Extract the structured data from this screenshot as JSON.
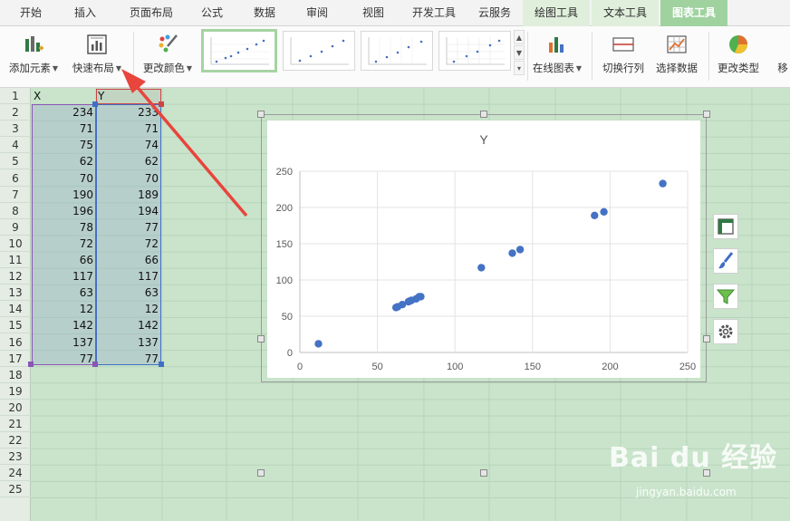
{
  "tabs": [
    "开始",
    "插入",
    "页面布局",
    "公式",
    "数据",
    "审阅",
    "视图",
    "开发工具",
    "云服务",
    "绘图工具",
    "文本工具",
    "图表工具"
  ],
  "ribbon": {
    "add_element": "添加元素",
    "quick_layout": "快速布局",
    "change_color": "更改颜色",
    "online_chart": "在线图表",
    "switch_row_col": "切换行列",
    "select_data": "选择数据",
    "change_type": "更改类型",
    "move": "移"
  },
  "sheet": {
    "rows": [
      "1",
      "2",
      "3",
      "4",
      "5",
      "6",
      "7",
      "8",
      "9",
      "10",
      "11",
      "12",
      "13",
      "14",
      "15",
      "16",
      "17",
      "18",
      "19",
      "20",
      "21",
      "22",
      "23",
      "24",
      "25"
    ],
    "header": {
      "x": "X",
      "y": "Y"
    },
    "x_values": [
      "234",
      "71",
      "75",
      "62",
      "70",
      "190",
      "196",
      "78",
      "72",
      "66",
      "117",
      "63",
      "12",
      "142",
      "137",
      "77"
    ],
    "y_values": [
      "233",
      "71",
      "74",
      "62",
      "70",
      "189",
      "194",
      "77",
      "72",
      "66",
      "117",
      "63",
      "12",
      "142",
      "137",
      "77"
    ]
  },
  "chart_data": {
    "type": "scatter",
    "title": "Y",
    "xlabel": "",
    "ylabel": "",
    "xlim": [
      0,
      250
    ],
    "ylim": [
      0,
      250
    ],
    "xticks": [
      "0",
      "50",
      "100",
      "150",
      "200",
      "250"
    ],
    "yticks": [
      "0",
      "50",
      "100",
      "150",
      "200",
      "250"
    ],
    "grid": true,
    "legend": "none",
    "color": "#4472c4",
    "x": [
      234,
      71,
      75,
      62,
      70,
      190,
      196,
      78,
      72,
      66,
      117,
      63,
      12,
      142,
      137,
      77
    ],
    "y": [
      233,
      71,
      74,
      62,
      70,
      189,
      194,
      77,
      72,
      66,
      117,
      63,
      12,
      142,
      137,
      77
    ]
  },
  "watermark": {
    "brand": "Bai du 经验",
    "url": "jingyan.baidu.com"
  },
  "colors": {
    "sheet_bg": "#c9e4cb",
    "accent": "#9fd29f",
    "arrow": "#e8453c",
    "point": "#4472c4"
  }
}
